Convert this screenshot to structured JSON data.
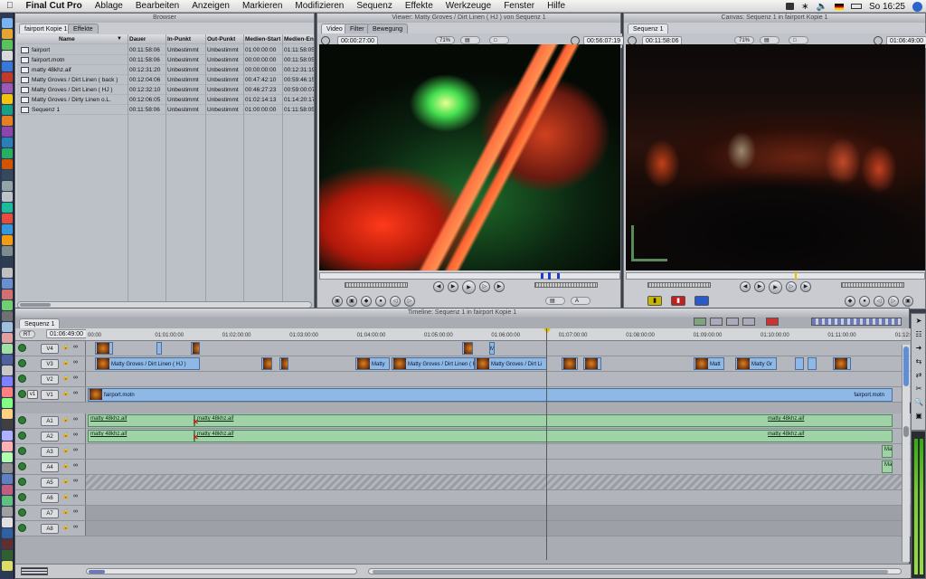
{
  "menubar": {
    "apple": "",
    "app": "Final Cut Pro",
    "items": [
      "Ablage",
      "Bearbeiten",
      "Anzeigen",
      "Markieren",
      "Modifizieren",
      "Sequenz",
      "Effekte",
      "Werkzeuge",
      "Fenster",
      "Hilfe"
    ],
    "clock": "So 16:25"
  },
  "browser": {
    "title": "Browser",
    "tabs": [
      "fairport Kopie 1",
      "Effekte"
    ],
    "columns": [
      "Name",
      "Dauer",
      "In-Punkt",
      "Out-Punkt",
      "Medien-Start",
      "Medien-End"
    ],
    "rows": [
      {
        "name": "fairport",
        "dauer": "00:11:58:06",
        "in": "Unbestimmt",
        "out": "Unbestimmt",
        "mstart": "01:00:00:00",
        "mend": "01:11:58:05"
      },
      {
        "name": "fairport.motn",
        "dauer": "00:11:58:06",
        "in": "Unbestimmt",
        "out": "Unbestimmt",
        "mstart": "00:00:00:00",
        "mend": "00:11:58:05"
      },
      {
        "name": "matty 48khz.aif",
        "dauer": "00:12:31:20",
        "in": "Unbestimmt",
        "out": "Unbestimmt",
        "mstart": "00:00:00:00",
        "mend": "00:12:31:19"
      },
      {
        "name": "Matty Groves / Dirt Linen ( back )",
        "dauer": "00:12:04:06",
        "in": "Unbestimmt",
        "out": "Unbestimmt",
        "mstart": "00:47:42:10",
        "mend": "00:59:46:15"
      },
      {
        "name": "Matty Groves / Dirt Linen ( HJ )",
        "dauer": "00:12:32:10",
        "in": "Unbestimmt",
        "out": "Unbestimmt",
        "mstart": "00:46:27:23",
        "mend": "00:59:00:07"
      },
      {
        "name": "Matty Groves / Dirty Linen o.L.",
        "dauer": "00:12:06:05",
        "in": "Unbestimmt",
        "out": "Unbestimmt",
        "mstart": "01:02:14:13",
        "mend": "01:14:20:17"
      },
      {
        "name": "Sequenz 1",
        "dauer": "00:11:58:06",
        "in": "Unbestimmt",
        "out": "Unbestimmt",
        "mstart": "01:00:00:00",
        "mend": "01:11:58:05"
      }
    ]
  },
  "viewer": {
    "title": "Viewer: Matty Groves / Dirt Linen ( HJ ) von Sequenz 1",
    "tabs": [
      "Video",
      "Filter",
      "Bewegung"
    ],
    "duration": "00:00:27:00",
    "zoom": "71%",
    "timecode": "00:56:07:19"
  },
  "canvas": {
    "title": "Canvas: Sequenz 1 in fairport Kopie 1",
    "tabs": [
      "Sequenz 1"
    ],
    "duration": "00:11:58:06",
    "zoom": "71%",
    "timecode": "01:06:49:00"
  },
  "timeline": {
    "title": "Timeline: Sequenz 1 in fairport Kopie 1",
    "tab": "Sequenz 1",
    "rt": "RT",
    "timecode": "01:06:49:00",
    "ruler": [
      "00:00",
      "01:01:00:00",
      "01:02:00:00",
      "01:03:00:00",
      "01:04:00:00",
      "01:05:00:00",
      "01:06:00:00",
      "01:07:00:00",
      "01:08:00:00",
      "01:09:00:00",
      "01:10:00:00",
      "01:11:00:00",
      "01:12:00"
    ],
    "video_tracks": [
      "V4",
      "V3",
      "V2",
      "V1"
    ],
    "audio_tracks": [
      "A1",
      "A2",
      "A3",
      "A4",
      "A5",
      "A6",
      "A7",
      "A8"
    ],
    "v1_source": "v1",
    "clip_labels": {
      "matty_hj": "Matty Groves / Dirt Linen ( HJ )",
      "matty_short": "Matty",
      "matty_hj2": "Matty Groves / Dirt Li",
      "matty_cr": "Matty Gr",
      "matty_m": "Matt",
      "fairport": "fairport.motn",
      "audio": "matty 48khz.aif",
      "ma": "Ma"
    }
  },
  "colors": {
    "video_clip": "#8eb8e6",
    "audio_clip": "#9fd3a7",
    "playhead": "#e0c000"
  }
}
